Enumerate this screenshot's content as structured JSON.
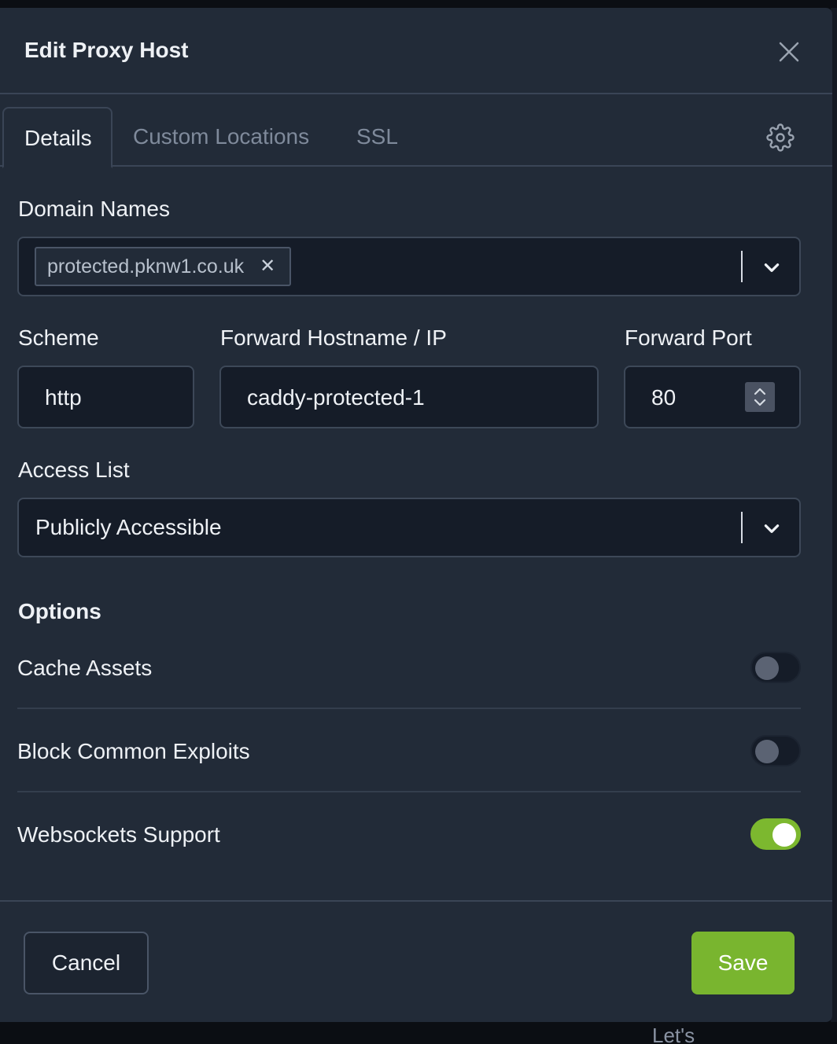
{
  "dialog": {
    "title": "Edit Proxy Host"
  },
  "tabs": [
    {
      "label": "Details",
      "active": true
    },
    {
      "label": "Custom Locations",
      "active": false
    },
    {
      "label": "SSL",
      "active": false
    }
  ],
  "details": {
    "domain_names": {
      "label": "Domain Names",
      "values": [
        "protected.pknw1.co.uk"
      ]
    },
    "scheme": {
      "label": "Scheme",
      "value": "http"
    },
    "forward_host": {
      "label": "Forward Hostname / IP",
      "value": "caddy-protected-1"
    },
    "forward_port": {
      "label": "Forward Port",
      "value": "80"
    },
    "access_list": {
      "label": "Access List",
      "value": "Publicly Accessible"
    }
  },
  "options": {
    "title": "Options",
    "items": [
      {
        "label": "Cache Assets",
        "enabled": false
      },
      {
        "label": "Block Common Exploits",
        "enabled": false
      },
      {
        "label": "Websockets Support",
        "enabled": true
      }
    ]
  },
  "footer": {
    "cancel_label": "Cancel",
    "save_label": "Save"
  },
  "background": {
    "bottom_right_text": "Let's"
  },
  "colors": {
    "modal_bg": "#222b38",
    "input_bg": "#151c28",
    "accent_green": "#7cb82f"
  }
}
